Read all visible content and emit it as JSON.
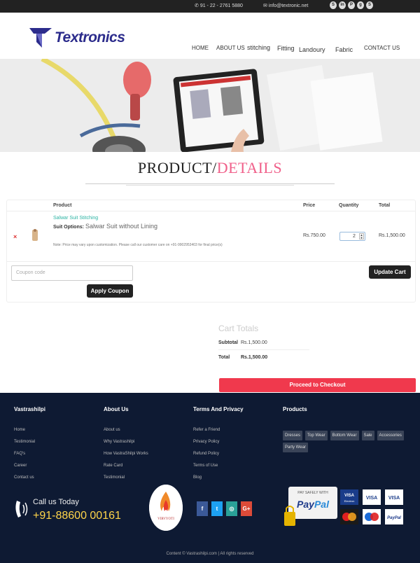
{
  "topbar": {
    "phone": "91 - 22 - 2761 5880",
    "email": "info@textronic.net",
    "social_icons": [
      "skype-icon",
      "linkedin-icon",
      "pinterest-icon",
      "google-plus-icon",
      "skype-icon"
    ]
  },
  "header": {
    "logo_text": "Textronics",
    "nav": [
      "HOME",
      "ABOUT US",
      "stitching",
      "Fitting",
      "Landoury",
      "Fabric",
      "CONTACT US"
    ]
  },
  "page_title": {
    "part1": "PRODUCT/",
    "part2": "DETAILS"
  },
  "cart": {
    "headers": {
      "product": "Product",
      "price": "Price",
      "quantity": "Quantity",
      "total": "Total"
    },
    "item": {
      "name": "Salwar Suit Stitching",
      "options_label": "Suit Options:",
      "options_value": "Salwar Suit without Lining",
      "note": "Note: Price may vary upon customization. Please call our customer care on +91-9902953403 for final price(s)",
      "price": "Rs.750.00",
      "quantity": "2",
      "total": "Rs.1,500.00"
    },
    "coupon_placeholder": "Coupon code",
    "apply_label": "Apply Coupon",
    "update_label": "Update Cart"
  },
  "totals": {
    "title": "Cart Totals",
    "subtotal_label": "Subtotal",
    "subtotal_value": "Rs.1,500.00",
    "total_label": "Total",
    "total_value": "Rs.1,500.00",
    "checkout_label": "Proceed to Checkout"
  },
  "footer": {
    "col1": {
      "title": "Vastrashilpi",
      "links": [
        "Home",
        "Testimonial",
        "FAQ's",
        "Career",
        "Contact us"
      ]
    },
    "col2": {
      "title": "About Us",
      "links": [
        "About us",
        "Why Vastrashilpi",
        "How VastraShilpi Works",
        "Rate Card",
        "Testimonial"
      ]
    },
    "col3": {
      "title": "Terms And Privacy",
      "links": [
        "Refer a Friend",
        "Privacy Policy",
        "Refund Policy",
        "Terms of Use",
        "Blog"
      ]
    },
    "col4": {
      "title": "Products",
      "tags": [
        "Dresses",
        "Top Wear",
        "Bottom Wear",
        "Sale",
        "Accessories",
        "Party Wear"
      ]
    },
    "call_label": "Call us Today",
    "call_number": "+91-88600 00161",
    "logo_text": "VIRVYOTI",
    "social": [
      "f",
      "t",
      "ig",
      "G+"
    ],
    "copyright": "Content © Vastrashilpi.com | All rights reserved",
    "pay_label": "PAY SAFELY WITH",
    "paypal": "PayPal",
    "cards": [
      "VISA Electron",
      "VISA",
      "VISA",
      "MasterCard",
      "Maestro",
      "PayPal"
    ],
    "colors": {
      "bg": "#0e1a33",
      "accent": "#ffd54a"
    }
  }
}
